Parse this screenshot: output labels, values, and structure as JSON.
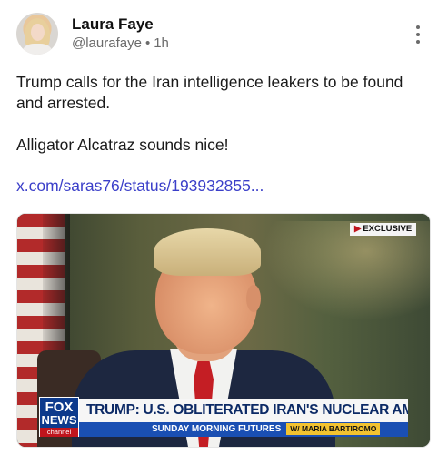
{
  "post": {
    "author_name": "Laura Faye",
    "handle": "@laurafaye",
    "separator": "•",
    "time": "1h",
    "text_line1": "Trump calls for the Iran intelligence leakers to be found and arrested.",
    "text_line2": "Alligator Alcatraz sounds nice!",
    "link_text": "x.com/saras76/status/193932855..."
  },
  "media": {
    "badge": "EXCLUSIVE",
    "logo_line1": "FOX",
    "logo_line2": "NEWS",
    "logo_line3": "channel",
    "headline": "TRUMP: U.S. OBLITERATED IRAN'S NUCLEAR AMBITIONS",
    "show_name": "SUNDAY MORNING FUTURES",
    "host_tag": "W/ MARIA BARTIROMO"
  },
  "icons": {
    "more": "more-vertical-icon",
    "avatar": "avatar"
  },
  "colors": {
    "link": "#3b3fc9",
    "muted": "#6b6b6b",
    "fox_blue": "#0d3a8c",
    "fox_red": "#c0151d"
  }
}
